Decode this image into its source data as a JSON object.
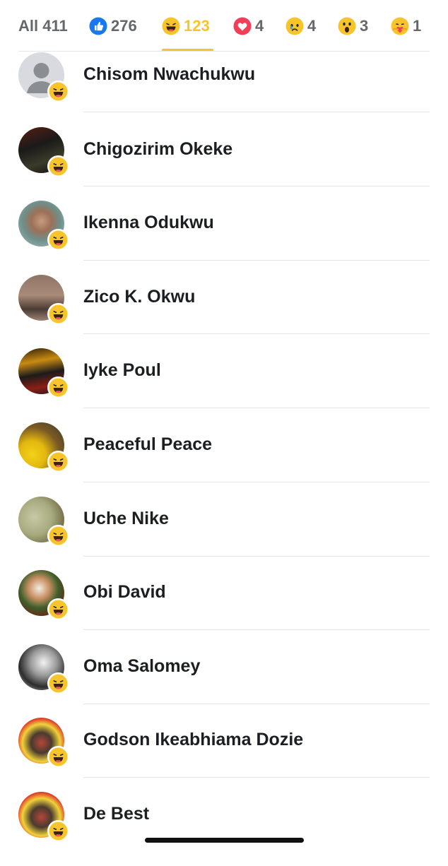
{
  "tabs": [
    {
      "label": "All 411",
      "icon": "",
      "active": false
    },
    {
      "label": "276",
      "icon": "like-icon",
      "active": false
    },
    {
      "label": "123",
      "icon": "haha-icon",
      "active": true
    },
    {
      "label": "4",
      "icon": "love-icon",
      "active": false
    },
    {
      "label": "4",
      "icon": "sad-icon",
      "active": false
    },
    {
      "label": "3",
      "icon": "wow-icon",
      "active": false
    },
    {
      "label": "1",
      "icon": "care-icon",
      "active": false
    }
  ],
  "colors": {
    "accent": "#f7c52b",
    "text": "#1c1e21",
    "muted": "#65676b",
    "like": "#1877f2",
    "love": "#f33e58"
  },
  "people": [
    {
      "name": "Chisom Nwachukwu",
      "reaction": "haha-icon",
      "avatar": "default-avatar"
    },
    {
      "name": "Chigozirim Okeke",
      "reaction": "haha-icon",
      "avatar": "photo"
    },
    {
      "name": "Ikenna Odukwu",
      "reaction": "haha-icon",
      "avatar": "photo"
    },
    {
      "name": "Zico K. Okwu",
      "reaction": "haha-icon",
      "avatar": "photo"
    },
    {
      "name": "Iyke Poul",
      "reaction": "haha-icon",
      "avatar": "photo"
    },
    {
      "name": "Peaceful Peace",
      "reaction": "haha-icon",
      "avatar": "photo"
    },
    {
      "name": "Uche Nike",
      "reaction": "haha-icon",
      "avatar": "photo"
    },
    {
      "name": "Obi David",
      "reaction": "haha-icon",
      "avatar": "photo"
    },
    {
      "name": "Oma Salomey",
      "reaction": "haha-icon",
      "avatar": "photo"
    },
    {
      "name": "Godson Ikeabhiama Dozie",
      "reaction": "haha-icon",
      "avatar": "photo"
    },
    {
      "name": "De Best",
      "reaction": "haha-icon",
      "avatar": "photo"
    }
  ]
}
